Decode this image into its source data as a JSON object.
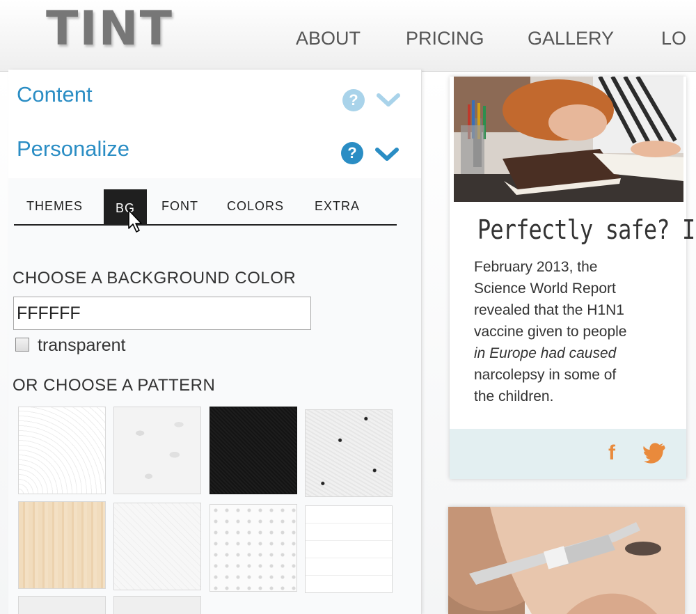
{
  "header": {
    "logo": "TINT",
    "nav": [
      "ABOUT",
      "PRICING",
      "GALLERY",
      "LO"
    ]
  },
  "sidebar": {
    "content_section": {
      "title": "Content"
    },
    "personalize_section": {
      "title": "Personalize"
    },
    "tabs": [
      "THEMES",
      "BG",
      "FONT",
      "COLORS",
      "EXTRA"
    ],
    "active_tab": "BG",
    "bg_color_label": "CHOOSE A BACKGROUND COLOR",
    "bg_color_value": "FFFFFF",
    "transparent_label": "transparent",
    "transparent_checked": false,
    "pattern_label": "OR CHOOSE A PATTERN",
    "patterns": [
      "curves",
      "floral-grey",
      "black-texture",
      "dotted-paper",
      "wood",
      "diagonal-light",
      "dots-light",
      "grid-light"
    ]
  },
  "feed": {
    "post": {
      "title": "Perfectly safe? In",
      "lines": [
        "February 2013, the",
        "Science World Report",
        "revealed that the H1N1",
        "vaccine given to people",
        "in Europe had caused",
        "narcolepsy in some of",
        "the children."
      ],
      "share_icons": [
        "facebook-icon",
        "twitter-icon"
      ]
    }
  },
  "colors": {
    "accent_blue": "#2a8dc4",
    "share_orange": "#e98a3c",
    "card_footer": "#e3eff1"
  }
}
